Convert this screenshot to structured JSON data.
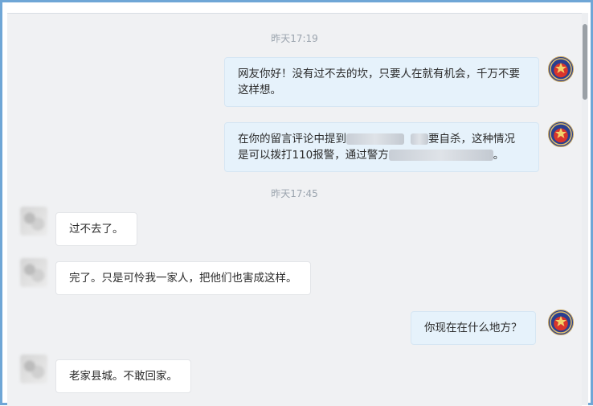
{
  "timestamps": [
    "昨天17:19",
    "昨天17:45"
  ],
  "messages": [
    {
      "side": "right",
      "text": "网友你好！没有过不去的坎，只要人在就有机会，千万不要这样想。"
    },
    {
      "side": "right",
      "line1_a": "在你的留言评论中提到",
      "line1_b": "要自杀，这种情况",
      "line2_a": "是可以拨打110报警，通过警方",
      "line2_b": "。"
    },
    {
      "side": "left",
      "text": "过不去了。"
    },
    {
      "side": "left",
      "text": "完了。只是可怜我一家人，把他们也害成这样。"
    },
    {
      "side": "right",
      "text": "你现在在什么地方？"
    },
    {
      "side": "left",
      "text": "老家县城。不敢回家。"
    }
  ],
  "icons": {
    "agent_avatar": "police-badge-icon",
    "user_avatar": "blurred-user-avatar"
  },
  "colors": {
    "frame_border": "#6fa6d6",
    "right_bubble": "#e6f2fb",
    "left_bubble": "#ffffff",
    "background": "#f0f1f3"
  }
}
